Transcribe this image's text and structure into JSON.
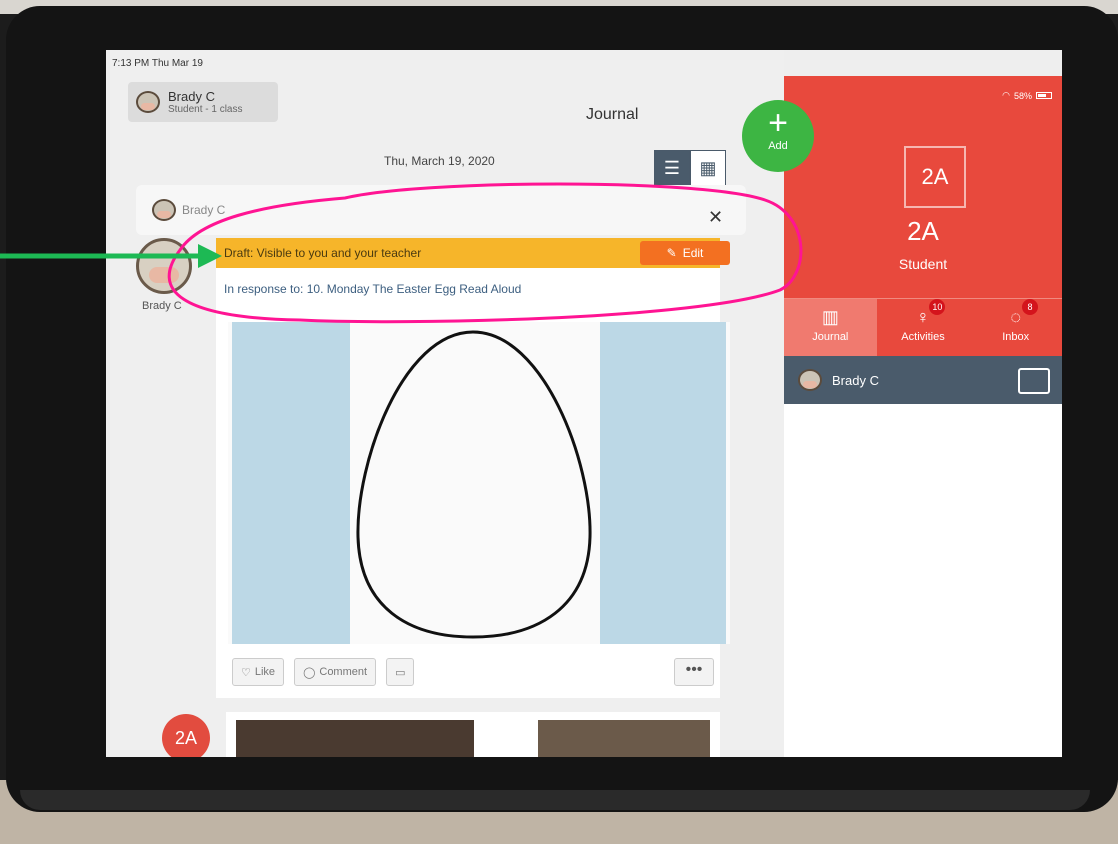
{
  "status_bar": {
    "time": "7:13 PM  Thu Mar 19",
    "battery": "58%"
  },
  "user_chip": {
    "name": "Brady C",
    "subtitle": "Student - 1 class"
  },
  "header": {
    "title": "Journal"
  },
  "add_button": {
    "label": "Add"
  },
  "date": "Thu, March 19, 2020",
  "post": {
    "author": "Brady C",
    "draft_notice": "Draft: Visible to you and your teacher",
    "edit_label": "Edit",
    "response": "In response to: 10. Monday The Easter Egg Read Aloud",
    "actions": {
      "like": "Like",
      "comment": "Comment",
      "more": "•••"
    }
  },
  "class_badge": "2A",
  "side_panel": {
    "class_box": "2A",
    "class_name": "2A",
    "role": "Student",
    "tabs": [
      {
        "label": "Journal",
        "icon": "book-icon"
      },
      {
        "label": "Activities",
        "icon": "lightbulb-icon",
        "badge": "10"
      },
      {
        "label": "Inbox",
        "icon": "chat-icon",
        "badge": "8"
      }
    ],
    "student": "Brady C"
  },
  "colors": {
    "accent_red": "#e8493d",
    "add_green": "#3db543",
    "draft_yellow": "#f6b52a",
    "edit_orange": "#f37021",
    "slate": "#4a5b6b",
    "annotation_pink": "#ff1493",
    "annotation_arrow": "#1db954"
  }
}
